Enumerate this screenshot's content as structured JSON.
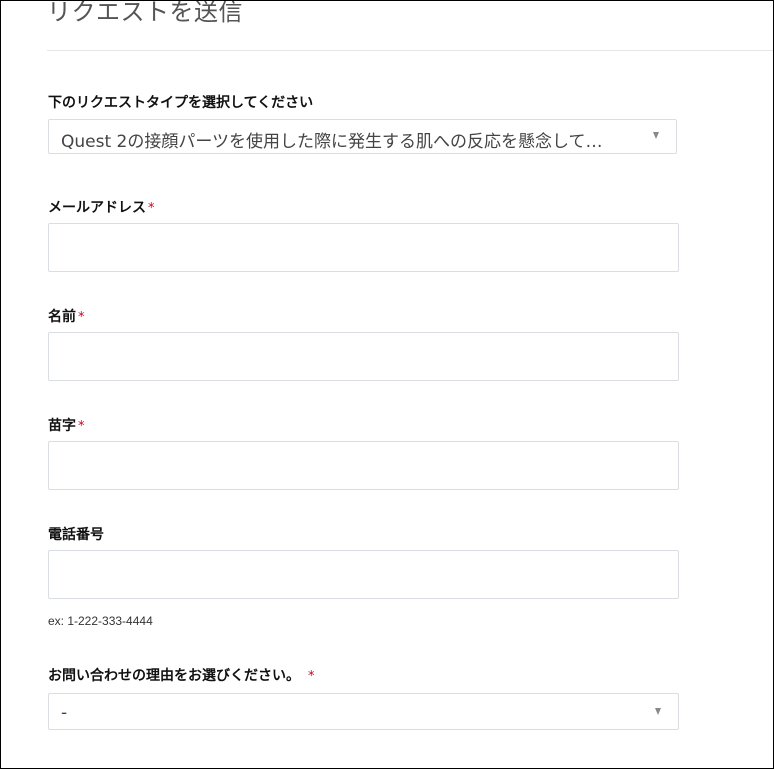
{
  "page": {
    "title": "リクエストを送信"
  },
  "request_type": {
    "label": "下のリクエストタイプを選択してください",
    "selected_value": "Quest 2の接顔パーツを使用した際に発生する肌への反応を懸念して…"
  },
  "email": {
    "label": "メールアドレス",
    "required_mark": "*",
    "value": ""
  },
  "first_name": {
    "label": "名前",
    "required_mark": "*",
    "value": ""
  },
  "last_name": {
    "label": "苗字",
    "required_mark": "*",
    "value": ""
  },
  "phone": {
    "label": "電話番号",
    "value": "",
    "hint": "ex: 1-222-333-4444"
  },
  "reason": {
    "label": "お問い合わせの理由をお選びください。",
    "required_mark": "*",
    "selected_value": "-"
  },
  "icons": {
    "dropdown": "chevron-down-icon"
  },
  "colors": {
    "required": "#d0021b",
    "border": "#dadde1",
    "title": "#555555"
  }
}
